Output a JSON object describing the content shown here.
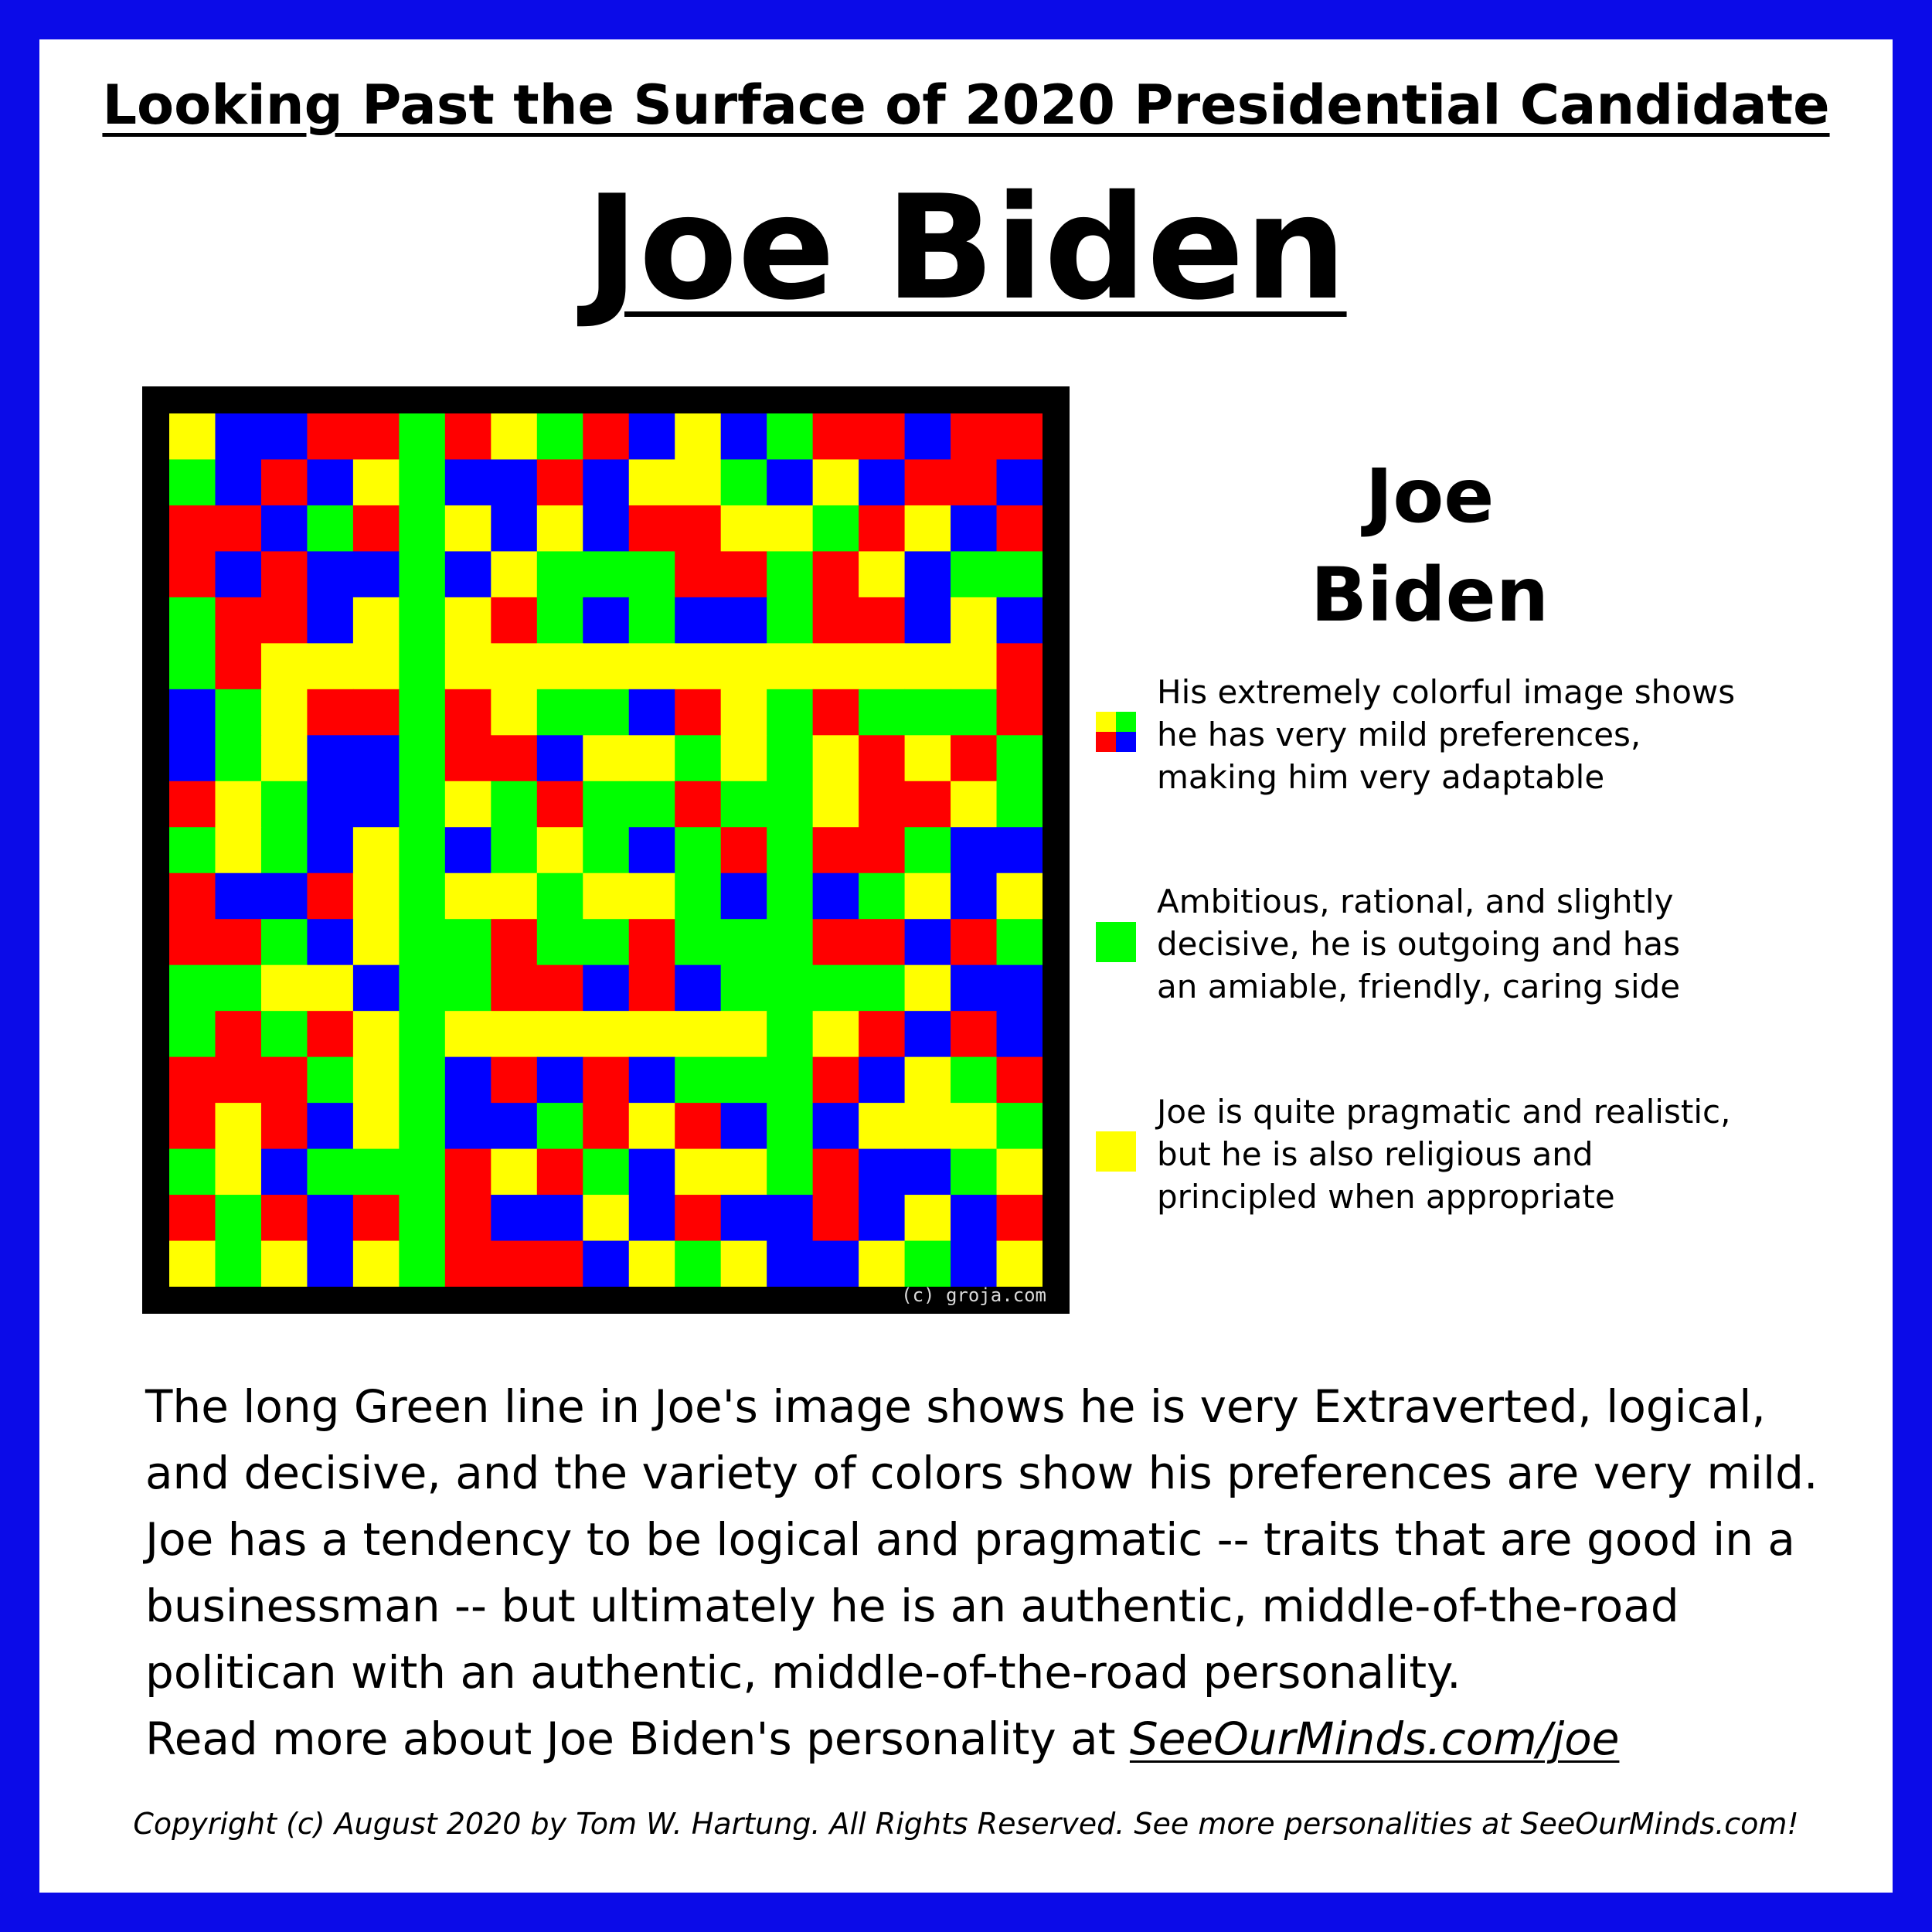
{
  "header": {
    "title": "Looking Past the Surface of 2020 Presidential Candidate",
    "name": "Joe Biden"
  },
  "mosaic": {
    "watermark": "(c) groja.com",
    "palette": {
      "R": "#ff0000",
      "G": "#00ff00",
      "B": "#0000ff",
      "Y": "#ffff00"
    },
    "rows": [
      "YBBRRGRYGRBYBGRRBRR",
      "GBRBYGBBRBYYGBYBRRB",
      "RRBGRGYBYBRRYYGRYBR",
      "RBRBBGBYGGGRRGRYBGG",
      "GRRBYGYRGBGBBGRRBYB",
      "GRYYYGYYYYYYYYYYYYR",
      "BGYRRGRYGGBRYGRGGGR",
      "BGYBBGRRBYYGYGYRYRG",
      "RYGBBGYGRGGRGGYRRYG",
      "GYGBYGBGYGBGRGRRGBB",
      "RBBRYGYYGYYGBGBGYBY",
      "RRGBYGGRGGRGGGRRBRG",
      "GGYYBGGRRBRBGGGGYBB",
      "GRGRYGYYYYYYYGYRBRB",
      "RRRGYGBRBRBGGGRBYGR",
      "RYRBYGBBGRYRBGBYYYG",
      "GYBGGGRYRGBYYGRBBGY",
      "RGRBRGRBBYBRBBRBYBR",
      "YGYBYGRRRBYGYBBYGBY"
    ]
  },
  "side_panel": {
    "name_line1": "Joe",
    "name_line2": "Biden",
    "traits": [
      {
        "icon": "four-color-square-icon",
        "colors": [
          "#ffff00",
          "#00ff00",
          "#ff0000",
          "#0000ff"
        ],
        "lines": [
          "His extremely colorful image shows",
          "he has very mild preferences,",
          "making him very adaptable"
        ]
      },
      {
        "icon": "green-square-icon",
        "color": "#00ff00",
        "lines": [
          "Ambitious, rational, and slightly",
          "decisive, he is outgoing and has",
          "an amiable, friendly, caring side"
        ]
      },
      {
        "icon": "yellow-square-icon",
        "color": "#ffff00",
        "lines": [
          "Joe is quite pragmatic and realistic,",
          "but he is also religious and",
          "principled when appropriate"
        ]
      }
    ]
  },
  "summary": {
    "lines": [
      "The long Green line in Joe's image shows he is very Extraverted, logical,",
      "and decisive, and the variety of colors show his preferences are very mild.",
      "Joe has a tendency to be logical and pragmatic -- traits that are good in a",
      "businessman -- but ultimately he is an authentic, middle-of-the-road",
      "politican with an authentic, middle-of-the-road personality."
    ],
    "read_more_prefix": "Read more about Joe Biden's personality at ",
    "read_more_link": "SeeOurMinds.com/joe"
  },
  "footer": {
    "copyright": "Copyright (c) August 2020 by Tom W. Hartung.  All Rights Reserved.  See more personalities at SeeOurMinds.com!"
  },
  "colors": {
    "border": "#0b0be8",
    "background": "#ffffff",
    "text": "#000000"
  }
}
